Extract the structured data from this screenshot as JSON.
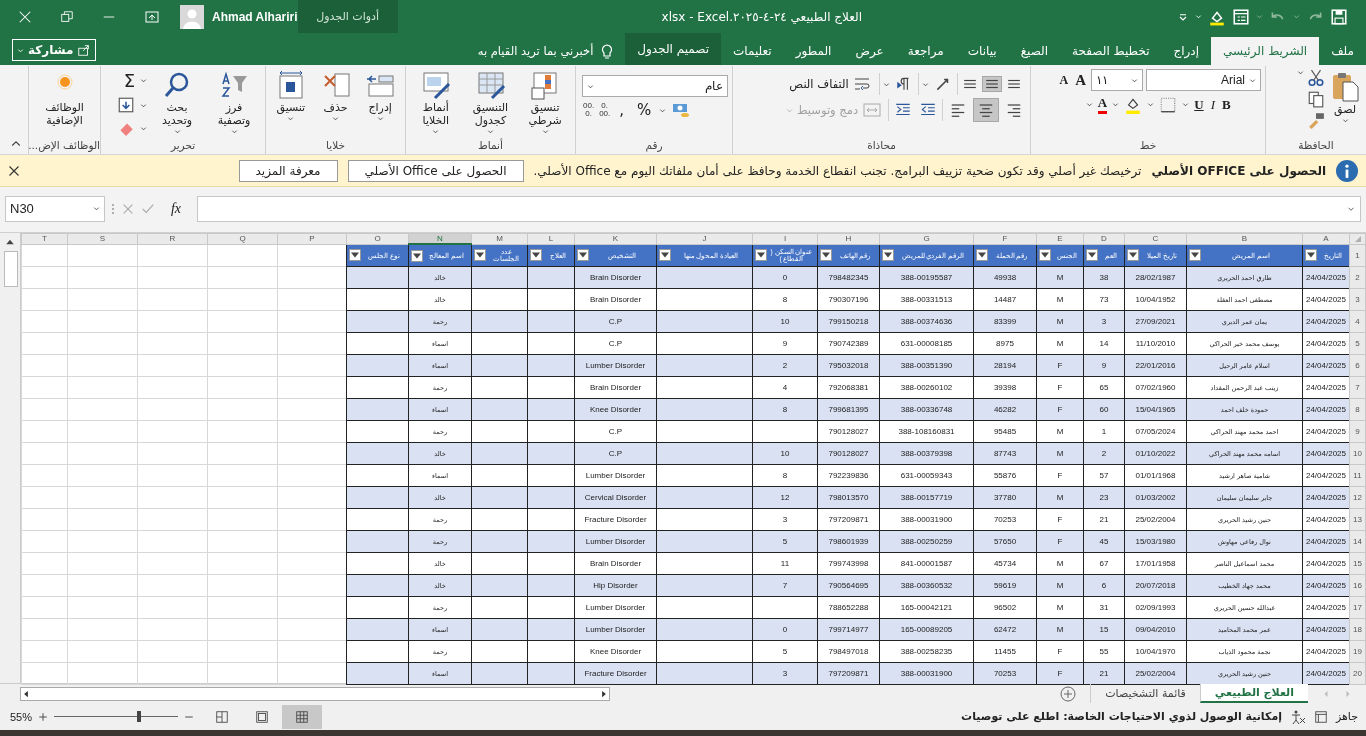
{
  "title_bar": {
    "title": "العلاج الطبيعي ٢٤-٤-٢٠٢٥.xlsx  -  Excel",
    "context_label": "أدوات الجدول",
    "user": "Ahmad Alhariri"
  },
  "ribbon_tabs": [
    {
      "label": "ملف",
      "selected": false,
      "contextual": false
    },
    {
      "label": "الشريط الرئيسي",
      "selected": true,
      "contextual": false
    },
    {
      "label": "إدراج",
      "selected": false,
      "contextual": false
    },
    {
      "label": "تخطيط الصفحة",
      "selected": false,
      "contextual": false
    },
    {
      "label": "الصيغ",
      "selected": false,
      "contextual": false
    },
    {
      "label": "بيانات",
      "selected": false,
      "contextual": false
    },
    {
      "label": "مراجعة",
      "selected": false,
      "contextual": false
    },
    {
      "label": "عرض",
      "selected": false,
      "contextual": false
    },
    {
      "label": "المطور",
      "selected": false,
      "contextual": false
    },
    {
      "label": "تعليمات",
      "selected": false,
      "contextual": false
    },
    {
      "label": "تصميم الجدول",
      "selected": false,
      "contextual": true
    }
  ],
  "tell_me": {
    "placeholder": "أخبرني بما تريد القيام به"
  },
  "share_button": "مشاركة",
  "ribbon": {
    "clipboard": {
      "label": "الحافظة",
      "paste": "لصق"
    },
    "font": {
      "label": "خط",
      "font_name": "Arial",
      "font_size": "١١",
      "size_buttons": [
        "A",
        "A"
      ],
      "style_buttons": [
        "B",
        "I",
        "U"
      ],
      "font_color": "A"
    },
    "alignment": {
      "label": "محاذاة",
      "vertical_align": [
        {
          "selected": false
        },
        {
          "selected": true
        },
        {
          "selected": false
        }
      ],
      "horizontal_align": [
        {
          "selected": false
        },
        {
          "selected": true
        },
        {
          "selected": false
        }
      ],
      "wrap_text": {
        "label": "التفاف النص",
        "disabled": false
      },
      "merge": {
        "label": "دمج وتوسيط",
        "disabled": true
      }
    },
    "number": {
      "label": "رقم",
      "format": "عام",
      "symbols": [
        "%",
        ","
      ],
      "decimal_buttons": [
        {
          "top": ".0",
          "bottom": ".00"
        },
        {
          "top": ".00",
          "bottom": ".0"
        }
      ]
    },
    "styles": {
      "label": "أنماط",
      "buttons": [
        "تنسيق شرطي",
        "التنسيق كجدول",
        "أنماط الخلايا"
      ]
    },
    "cells": {
      "label": "خلايا",
      "buttons": [
        "إدراج",
        "حذف",
        "تنسيق"
      ]
    },
    "editing": {
      "label": "تحرير",
      "sum": "Σ",
      "buttons": [
        "فرز وتصفية",
        "بحث وتحديد"
      ]
    },
    "addins": {
      "label": "الوظائف الإض...",
      "button": "الوظائف الإضافية"
    }
  },
  "message_bar": {
    "title": "الحصول على OFFICE الأصلي",
    "text": "ترخيصك غير أصلي وقد تكون ضحية تزييف البرامج. تجنب انقطاع الخدمة وحافظ على أمان ملفاتك اليوم مع Office الأصلي.",
    "buttons": [
      "الحصول على Office الأصلي",
      "معرفة المزيد"
    ]
  },
  "formula_bar": {
    "name_box": "N30",
    "function_label": "fx"
  },
  "sheet": {
    "header_row": "1",
    "columns": [
      {
        "letter": "A",
        "heading": "التاريخ",
        "selected": false
      },
      {
        "letter": "B",
        "heading": "اسم المريض",
        "selected": false
      },
      {
        "letter": "C",
        "heading": "تاريخ الميلا",
        "selected": false
      },
      {
        "letter": "D",
        "heading": "العم",
        "selected": false
      },
      {
        "letter": "E",
        "heading": "الجنس",
        "selected": false
      },
      {
        "letter": "F",
        "heading": "رقم الحملة",
        "selected": false
      },
      {
        "letter": "G",
        "heading": "الرقم الفردي للمريض",
        "selected": false
      },
      {
        "letter": "H",
        "heading": "رقم الهاتف",
        "selected": false
      },
      {
        "letter": "I",
        "heading": "عنوان السكن ( القطاع )",
        "selected": false
      },
      {
        "letter": "J",
        "heading": "العيادة المحول منها",
        "selected": false
      },
      {
        "letter": "K",
        "heading": "التشخيص",
        "selected": false
      },
      {
        "letter": "L",
        "heading": "العلاج",
        "selected": false
      },
      {
        "letter": "M",
        "heading": "عدد الجلسات",
        "selected": false
      },
      {
        "letter": "N",
        "heading": "اسم المعالج",
        "selected": true
      },
      {
        "letter": "O",
        "heading": "نوع الجلس",
        "selected": false
      },
      {
        "letter": "P",
        "selected": false
      },
      {
        "letter": "Q",
        "selected": false
      },
      {
        "letter": "R",
        "selected": false
      },
      {
        "letter": "S",
        "selected": false
      },
      {
        "letter": "T",
        "selected": false
      }
    ],
    "rows": [
      {
        "number": "2",
        "cells": [
          "24/04/2025",
          "طارق احمد الحريري",
          "28/02/1987",
          "38",
          "M",
          "49938",
          "388-00195587",
          "798482345",
          "0",
          null,
          "Brain Disorder",
          null,
          null,
          "خالد",
          null
        ]
      },
      {
        "number": "3",
        "cells": [
          "24/04/2025",
          "مصطفى احمد العقلة",
          "10/04/1952",
          "73",
          "M",
          "14487",
          "388-00331513",
          "790307196",
          "8",
          null,
          "Brain Disorder",
          null,
          null,
          "خالد",
          null
        ]
      },
      {
        "number": "4",
        "cells": [
          "24/04/2025",
          "يمان عمر الدبري",
          "27/09/2021",
          "3",
          "M",
          "83399",
          "388-00374636",
          "799150218",
          "10",
          null,
          "C.P",
          null,
          null,
          "رحمة",
          null
        ]
      },
      {
        "number": "5",
        "cells": [
          "24/04/2025",
          "يوسف محمد خير الحراكي",
          "11/10/2010",
          "14",
          "M",
          "8975",
          "631-00008185",
          "790742389",
          "9",
          null,
          "C.P",
          null,
          null,
          "اسماء",
          null
        ]
      },
      {
        "number": "6",
        "cells": [
          "24/04/2025",
          "اسلام عامر الرحيل",
          "22/01/2016",
          "9",
          "F",
          "28194",
          "388-00351390",
          "795032018",
          "2",
          null,
          "Lumber Disorder",
          null,
          null,
          "اسماء",
          null
        ]
      },
      {
        "number": "7",
        "cells": [
          "24/04/2025",
          "زينب عبد الرحمن المقداد",
          "07/02/1960",
          "65",
          "F",
          "39398",
          "388-00260102",
          "792068381",
          "4",
          null,
          "Brain Disorder",
          null,
          null,
          "رحمة",
          null
        ]
      },
      {
        "number": "8",
        "cells": [
          "24/04/2025",
          "حمودة خلف احمد",
          "15/04/1965",
          "60",
          "F",
          "46282",
          "388-00336748",
          "799681395",
          "8",
          null,
          "Knee Disorder",
          null,
          null,
          "اسماء",
          null
        ]
      },
      {
        "number": "9",
        "cells": [
          "24/04/2025",
          "احمد محمد مهند الحراكي",
          "07/05/2024",
          "1",
          "M",
          "95485",
          "388-108160831",
          "790128027",
          null,
          null,
          "C.P",
          null,
          null,
          "رحمة",
          null
        ]
      },
      {
        "number": "10",
        "cells": [
          "24/04/2025",
          "اسامه محمد مهند الحراكي",
          "01/10/2022",
          "2",
          "M",
          "87743",
          "388-00379398",
          "790128027",
          "10",
          null,
          "C.P",
          null,
          null,
          "خالد",
          null
        ]
      },
      {
        "number": "11",
        "cells": [
          "24/04/2025",
          "شامية صاهر ارشيد",
          "01/01/1968",
          "57",
          "F",
          "55876",
          "631-00059343",
          "792239836",
          "8",
          null,
          "Lumber Disorder",
          null,
          null,
          "اسماء",
          null
        ]
      },
      {
        "number": "12",
        "cells": [
          "24/04/2025",
          "جابر سليمان سليمان",
          "01/03/2002",
          "23",
          "M",
          "37780",
          "388-00157719",
          "798013570",
          "12",
          null,
          "Cervical Disorder",
          null,
          null,
          "خالد",
          null
        ]
      },
      {
        "number": "13",
        "cells": [
          "24/04/2025",
          "حنين رشيد الحريري",
          "25/02/2004",
          "21",
          "F",
          "70253",
          "388-00031900",
          "797209871",
          "3",
          null,
          "Fracture Disorder",
          null,
          null,
          "رحمة",
          null
        ]
      },
      {
        "number": "14",
        "cells": [
          "24/04/2025",
          "نوال رفاعي مهاوش",
          "15/03/1980",
          "45",
          "F",
          "57650",
          "388-00250259",
          "798601939",
          "5",
          null,
          "Lumber Disorder",
          null,
          null,
          "رحمة",
          null
        ]
      },
      {
        "number": "15",
        "cells": [
          "24/04/2025",
          "محمد اسماعيل الناصر",
          "17/01/1958",
          "67",
          "M",
          "45734",
          "841-00001587",
          "799743998",
          "11",
          null,
          "Brain Disorder",
          null,
          null,
          "خالد",
          null
        ]
      },
      {
        "number": "16",
        "cells": [
          "24/04/2025",
          "محمد جهاد الخطيب",
          "20/07/2018",
          "6",
          "M",
          "59619",
          "388-00360532",
          "790564695",
          "7",
          null,
          "Hip Disorder",
          null,
          null,
          "خالد",
          null
        ]
      },
      {
        "number": "17",
        "cells": [
          "24/04/2025",
          "عبدالله حسين الحريري",
          "02/09/1993",
          "31",
          "M",
          "96502",
          "165-00042121",
          "788652288",
          null,
          null,
          "Lumber Disorder",
          null,
          null,
          "رحمة",
          null
        ]
      },
      {
        "number": "18",
        "cells": [
          "24/04/2025",
          "عمر محمد المحاميد",
          "09/04/2010",
          "15",
          "M",
          "62472",
          "165-00089205",
          "799714977",
          "0",
          null,
          "Lumber Disorder",
          null,
          null,
          "اسماء",
          null
        ]
      },
      {
        "number": "19",
        "cells": [
          "24/04/2025",
          "نجمة محمود الذياب",
          "10/04/1970",
          "55",
          "F",
          "11455",
          "388-00258235",
          "798497018",
          "5",
          null,
          "Knee Disorder",
          null,
          null,
          "رحمة",
          null
        ]
      },
      {
        "number": "20",
        "cells": [
          "24/04/2025",
          "حنين رشيد الحريري",
          "25/02/2004",
          "21",
          "F",
          "70253",
          "388-00031900",
          "797209871",
          "3",
          null,
          "Fracture Disorder",
          null,
          null,
          "اسماء",
          null
        ]
      }
    ]
  },
  "sheet_tabs": [
    {
      "label": "العلاج الطبيعي",
      "selected": true
    },
    {
      "label": "قائمة التشخيصات",
      "selected": false
    }
  ],
  "status_bar": {
    "status": "جاهز",
    "accessibility": "إمكانية الوصول لذوي الاحتياجات الخاصة: اطلع على توصيات",
    "views": [
      {
        "selected": true
      },
      {
        "selected": false
      },
      {
        "selected": false
      }
    ],
    "zoom": {
      "reading": "55%"
    }
  }
}
